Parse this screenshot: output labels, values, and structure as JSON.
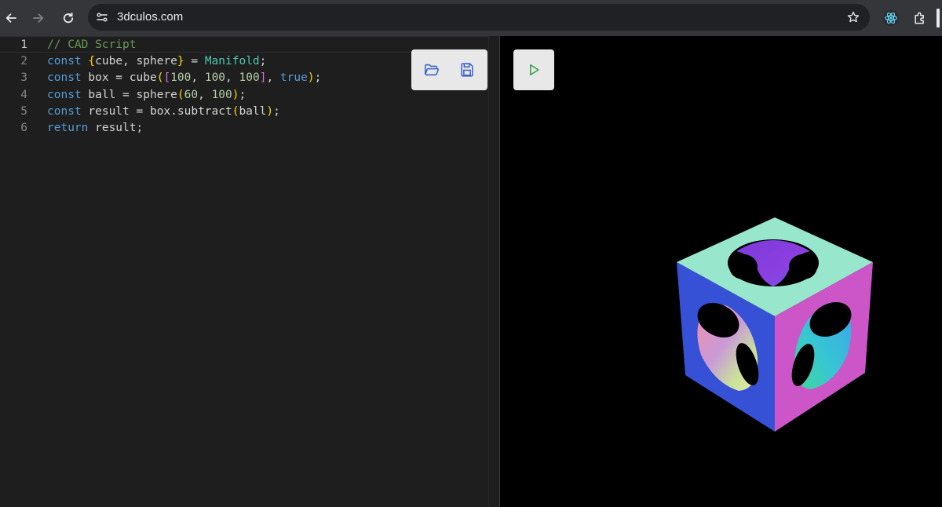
{
  "browser": {
    "url": "3dculos.com",
    "icons": [
      "back-icon",
      "forward-icon",
      "reload-icon",
      "site-settings-icon",
      "bookmark-star-icon",
      "react-devtools-icon",
      "extensions-icon"
    ]
  },
  "editor": {
    "active_line": 1,
    "lines": [
      {
        "n": "1",
        "parts": [
          {
            "c": "cm",
            "t": "// CAD Script"
          }
        ]
      },
      {
        "n": "2",
        "parts": [
          {
            "c": "kw",
            "t": "const "
          },
          {
            "c": "br1",
            "t": "{"
          },
          {
            "c": "",
            "t": "cube, sphere"
          },
          {
            "c": "br1",
            "t": "}"
          },
          {
            "c": "",
            "t": " = "
          },
          {
            "c": "cls",
            "t": "Manifold"
          },
          {
            "c": "",
            "t": ";"
          }
        ]
      },
      {
        "n": "3",
        "parts": [
          {
            "c": "kw",
            "t": "const "
          },
          {
            "c": "",
            "t": "box = cube"
          },
          {
            "c": "br1",
            "t": "("
          },
          {
            "c": "br2",
            "t": "["
          },
          {
            "c": "num",
            "t": "100"
          },
          {
            "c": "",
            "t": ", "
          },
          {
            "c": "num",
            "t": "100"
          },
          {
            "c": "",
            "t": ", "
          },
          {
            "c": "num",
            "t": "100"
          },
          {
            "c": "br2",
            "t": "]"
          },
          {
            "c": "",
            "t": ", "
          },
          {
            "c": "kw",
            "t": "true"
          },
          {
            "c": "br1",
            "t": ")"
          },
          {
            "c": "",
            "t": ";"
          }
        ]
      },
      {
        "n": "4",
        "parts": [
          {
            "c": "kw",
            "t": "const "
          },
          {
            "c": "",
            "t": "ball = sphere"
          },
          {
            "c": "br1",
            "t": "("
          },
          {
            "c": "num",
            "t": "60"
          },
          {
            "c": "",
            "t": ", "
          },
          {
            "c": "num",
            "t": "100"
          },
          {
            "c": "br1",
            "t": ")"
          },
          {
            "c": "",
            "t": ";"
          }
        ]
      },
      {
        "n": "5",
        "parts": [
          {
            "c": "kw",
            "t": "const "
          },
          {
            "c": "",
            "t": "result = box.subtract"
          },
          {
            "c": "br1",
            "t": "("
          },
          {
            "c": "",
            "t": "ball"
          },
          {
            "c": "br1",
            "t": ")"
          },
          {
            "c": "",
            "t": ";"
          }
        ]
      },
      {
        "n": "6",
        "parts": [
          {
            "c": "kw",
            "t": "return "
          },
          {
            "c": "",
            "t": "result;"
          }
        ]
      }
    ]
  },
  "toolbar": {
    "open_icon": "folder-open-icon",
    "save_icon": "save-icon",
    "run_icon": "play-icon",
    "accent": "#3b63c9",
    "run_color": "#2e9e3e"
  },
  "viewer": {
    "model": "cube-minus-sphere",
    "colors": {
      "top": "#98e6cc",
      "left": "#3650d6",
      "right": "#cc55c8"
    }
  }
}
